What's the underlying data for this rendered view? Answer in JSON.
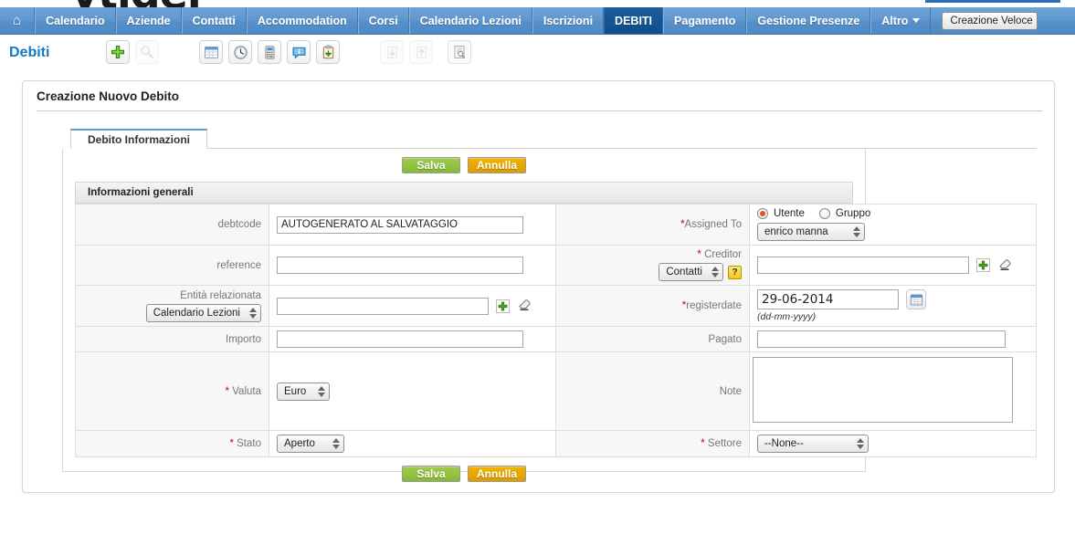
{
  "nav": {
    "home_icon": "home-icon",
    "items": [
      {
        "label": "Calendario",
        "active": false
      },
      {
        "label": "Aziende",
        "active": false
      },
      {
        "label": "Contatti",
        "active": false
      },
      {
        "label": "Accommodation",
        "active": false
      },
      {
        "label": "Corsi",
        "active": false
      },
      {
        "label": "Calendario Lezioni",
        "active": false
      },
      {
        "label": "Iscrizioni",
        "active": false
      },
      {
        "label": "DEBITI",
        "active": true
      },
      {
        "label": "Pagamento",
        "active": false
      },
      {
        "label": "Gestione Presenze",
        "active": false
      },
      {
        "label": "Altro",
        "active": false,
        "has_caret": true
      }
    ],
    "quick_create": "Creazione Veloce"
  },
  "module": {
    "title": "Debiti",
    "toolbar": {
      "group1": [
        {
          "name": "add-record-button",
          "icon": "green-plus-icon",
          "disabled": false
        },
        {
          "name": "search-button",
          "icon": "magnifier-icon",
          "disabled": true
        }
      ],
      "group2": [
        {
          "name": "list-view-button",
          "icon": "list-grid-icon",
          "disabled": false
        },
        {
          "name": "history-button",
          "icon": "clock-icon",
          "disabled": false
        },
        {
          "name": "device-button",
          "icon": "calculator-icon",
          "disabled": false
        },
        {
          "name": "info-button",
          "icon": "info-bubble-icon",
          "disabled": false
        },
        {
          "name": "clipboard-button",
          "icon": "clipboard-import-icon",
          "disabled": false
        }
      ],
      "group3": [
        {
          "name": "import-button",
          "icon": "arrow-down-icon",
          "disabled": true
        },
        {
          "name": "export-button",
          "icon": "arrow-up-icon",
          "disabled": true
        },
        {
          "name": "find-duplicates-button",
          "icon": "document-search-icon",
          "disabled": false
        }
      ]
    }
  },
  "panel": {
    "title": "Creazione Nuovo Debito",
    "tabs": [
      {
        "label": "Debito Informazioni",
        "active": true
      }
    ],
    "buttons": {
      "save": "Salva",
      "cancel": "Annulla"
    },
    "block_title": "Informazioni generali"
  },
  "form": {
    "debtcode": {
      "label": "debtcode",
      "value": "AUTOGENERATO AL SALVATAGGIO",
      "required": false
    },
    "assigned_to": {
      "label": "Assigned To",
      "required": true,
      "radio_user": "Utente",
      "radio_group": "Gruppo",
      "selected_radio": "Utente",
      "user_value": "enrico manna"
    },
    "reference": {
      "label": "reference",
      "value": "",
      "required": false
    },
    "creditor": {
      "label": "Creditor",
      "required": true,
      "module_select": "Contatti",
      "help_icon": "?",
      "value": ""
    },
    "entita_relazionata": {
      "label": "Entità relazionata",
      "required": false,
      "module_select": "Calendario Lezioni",
      "value": ""
    },
    "registerdate": {
      "label": "registerdate",
      "required": true,
      "value": "29-06-2014",
      "hint": "(dd-mm-yyyy)"
    },
    "importo": {
      "label": "Importo",
      "value": "",
      "required": false
    },
    "pagato": {
      "label": "Pagato",
      "value": "",
      "required": false
    },
    "valuta": {
      "label": "Valuta",
      "required": true,
      "value": "Euro"
    },
    "note": {
      "label": "Note",
      "required": false,
      "value": ""
    },
    "stato": {
      "label": "Stato",
      "required": true,
      "value": "Aperto"
    },
    "settore": {
      "label": "Settore",
      "required": true,
      "value": "--None--"
    }
  },
  "colors": {
    "nav_blue": "#5f97ce",
    "active_tab": "#0f4d8a",
    "title_blue": "#1479c4",
    "save_green": "#86bb33",
    "cancel_orange": "#e09b00",
    "required_red": "#cc0000"
  }
}
